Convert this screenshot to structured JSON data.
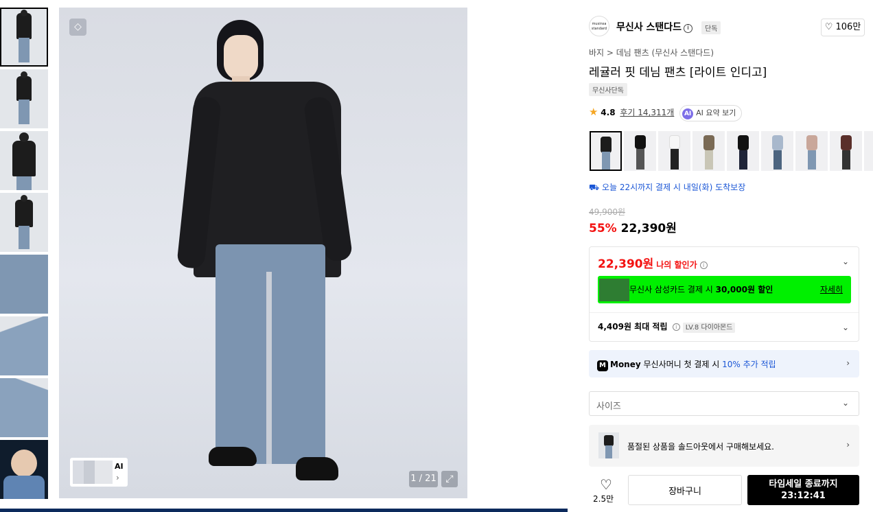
{
  "gallery": {
    "counter": "1 / 21",
    "ai_label": "AI"
  },
  "brand": {
    "logo_text": "musinsa standard",
    "name": "무신사 스탠다드",
    "exclusive_badge": "단독",
    "likes": "106만"
  },
  "product": {
    "breadcrumb": "바지 > 데님 팬츠 (무신사 스탠다드)",
    "title": "레귤러 핏 데님 팬츠 [라이트 인디고]",
    "tag": "무신사단독",
    "rating": "4.8",
    "reviews": "후기 14,311개",
    "ai_summary": "AI 요약 보기"
  },
  "delivery": "오늘 22시까지 결제 시 내일(화) 도착보장",
  "price": {
    "original": "49,900원",
    "discount": "55%",
    "final": "22,390원"
  },
  "benefit": {
    "my_price": "22,390원",
    "my_price_label": "나의 할인가",
    "card_text_pre": "무신사 삼성카드 결제 시 ",
    "card_text_bold": "30,000원 할인",
    "card_detail": "자세히",
    "points": "4,409원 최대 적립",
    "level": "LV.8 다이아몬드"
  },
  "money": {
    "brand": "Money",
    "text_pre": " 무신사머니 첫 결제 시 ",
    "text_blue": "10% 추가 적립"
  },
  "size_placeholder": "사이즈",
  "soldout_text": "품절된 상품을 솔드아웃에서 구매해보세요.",
  "actions": {
    "like_count": "2.5만",
    "cart": "장바구니",
    "timesale_label": "타임세일 종료까지",
    "timesale_time": "23:12:41"
  },
  "colors": {
    "accent_red": "#f31110",
    "accent_blue": "#1a56d6",
    "card_green": "#00f000"
  }
}
